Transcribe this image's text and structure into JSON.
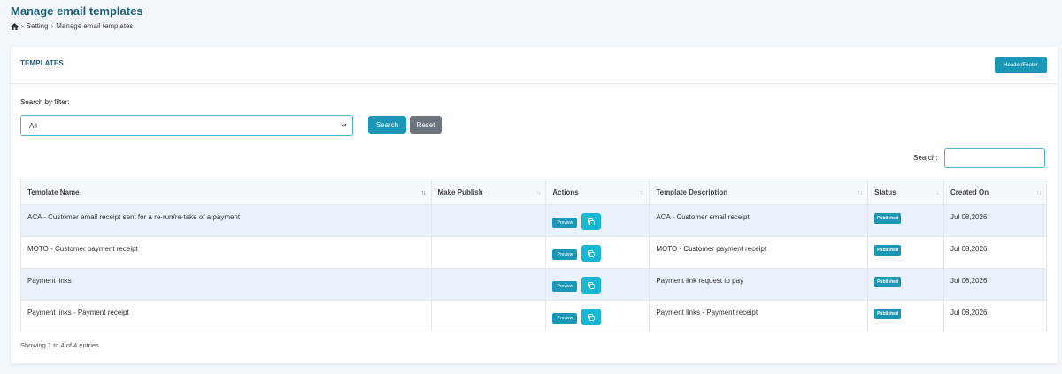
{
  "page": {
    "title": "Manage email templates",
    "breadcrumb": [
      "Setting",
      "Manage email templates"
    ]
  },
  "card": {
    "title": "TEMPLATES",
    "header_footer_button": "Header/Footer"
  },
  "filter": {
    "label": "Search by filter:",
    "selected": "All",
    "search_button": "Search",
    "reset_button": "Reset"
  },
  "table_search": {
    "label": "Search:",
    "value": ""
  },
  "table": {
    "columns": [
      "Template Name",
      "Make Publish",
      "Actions",
      "Template Description",
      "Status",
      "Created On"
    ],
    "rows": [
      {
        "name": "ACA - Customer email receipt sent for a re-run/re-take of a payment",
        "publish": "",
        "preview": "Preview",
        "description": "ACA - Customer email receipt",
        "status": "Published",
        "created": "Jul 08,2026"
      },
      {
        "name": "MOTO - Customer payment receipt",
        "publish": "",
        "preview": "Preview",
        "description": "MOTO - Customer payment receipt",
        "status": "Published",
        "created": "Jul 08,2026"
      },
      {
        "name": "Payment links",
        "publish": "",
        "preview": "Preview",
        "description": "Payment link request to pay",
        "status": "Published",
        "created": "Jul 08,2026"
      },
      {
        "name": "Payment links - Payment receipt",
        "publish": "",
        "preview": "Preview",
        "description": "Payment links - Payment receipt",
        "status": "Published",
        "created": "Jul 08,2026"
      }
    ]
  },
  "footer": {
    "info": "Showing 1 to 4 of 4 entries"
  },
  "colors": {
    "primary": "#1a97b6",
    "copy_button": "#16b8d4",
    "reset": "#6c757d",
    "title": "#1f5e7a"
  }
}
